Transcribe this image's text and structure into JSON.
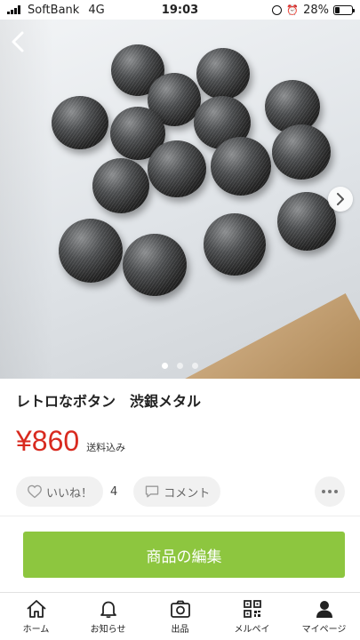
{
  "status_bar": {
    "carrier": "SoftBank",
    "network": "4G",
    "time": "19:03",
    "battery_percent": "28%",
    "battery_level": 0.28
  },
  "photo": {
    "page_count": 3,
    "active_page": 1
  },
  "item": {
    "title": "レトロなボタン　渋銀メタル",
    "price": "¥860",
    "shipping_note": "送料込み"
  },
  "actions": {
    "like_label": "いいね！",
    "like_count": "4",
    "comment_label": "コメント"
  },
  "edit_button_label": "商品の編集",
  "bottom_nav": {
    "home": "ホーム",
    "notifications": "お知らせ",
    "sell": "出品",
    "merpay": "メルペイ",
    "mypage": "マイページ"
  },
  "colors": {
    "price": "#d82a1f",
    "edit_button": "#8dc63f"
  }
}
